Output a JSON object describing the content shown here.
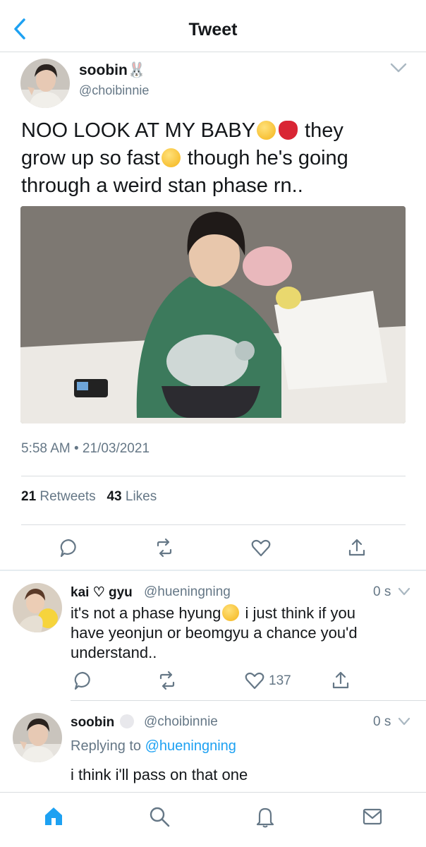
{
  "header": {
    "title": "Tweet"
  },
  "tweet": {
    "name": "soobin🐰",
    "handle": "@choibinnie",
    "text_line1": "NOO LOOK AT MY BABY",
    "text_line1_after": " they",
    "text_line2": "grow up so fast",
    "text_line2_after": " though he's going",
    "text_line3": "through a weird stan phase rn..",
    "timestamp": "5:58 AM • 21/03/2021",
    "retweets": "21",
    "retweets_label": "Retweets",
    "likes": "43",
    "likes_label": "Likes"
  },
  "replies": [
    {
      "name": "kai ♡ gyu",
      "handle": "@hueningning",
      "time": "0 s",
      "text_a": "it's not a phase hyung",
      "text_b": " i just think if you",
      "text_c": "have yeonjun or beomgyu a chance you'd",
      "text_d": "understand..",
      "like_count": "137"
    },
    {
      "name": "soobin",
      "handle": "@choibinnie",
      "time": "0 s",
      "replying_label": "Replying to",
      "replying_to": "@hueningning",
      "text": "i think i'll pass on that one"
    }
  ],
  "icons": [
    "back-icon",
    "chevron-down-icon",
    "reply-icon",
    "retweet-icon",
    "heart-icon",
    "share-icon",
    "home-icon",
    "search-icon",
    "bell-icon",
    "mail-icon"
  ],
  "colors": {
    "accent": "#1da1f2",
    "muted": "#657786",
    "divider": "#d9dde0"
  }
}
